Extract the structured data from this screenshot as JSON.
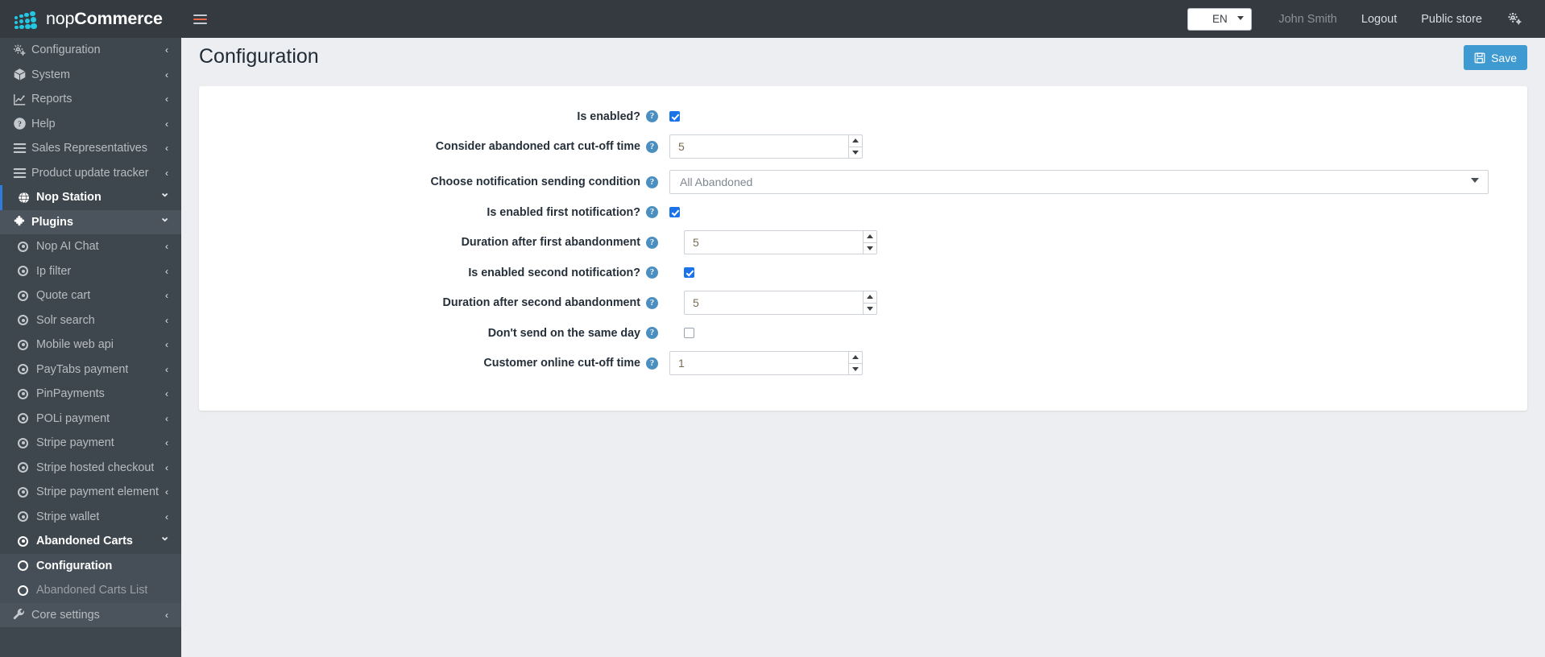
{
  "topbar": {
    "brand_light": "nop",
    "brand_bold": "Commerce",
    "menu_icon": "hamburger-icon",
    "language": "EN",
    "user": "John Smith",
    "logout": "Logout",
    "public_store": "Public store",
    "settings_icon": "gear-icon"
  },
  "sidebar": {
    "items": [
      {
        "label": "Configuration",
        "icon": "gears-icon",
        "caret": "‹",
        "level": 0,
        "style": "normal"
      },
      {
        "label": "System",
        "icon": "box-icon",
        "caret": "‹",
        "level": 0,
        "style": "normal"
      },
      {
        "label": "Reports",
        "icon": "chart-icon",
        "caret": "‹",
        "level": 0,
        "style": "normal"
      },
      {
        "label": "Help",
        "icon": "question-circle-icon",
        "caret": "‹",
        "level": 0,
        "style": "normal"
      },
      {
        "label": "Sales Representatives",
        "icon": "list-icon",
        "caret": "‹",
        "level": 0,
        "style": "normal"
      },
      {
        "label": "Product update tracker",
        "icon": "list-icon",
        "caret": "‹",
        "level": 0,
        "style": "normal"
      },
      {
        "label": "Nop Station",
        "icon": "globe-icon",
        "caret": "⌄",
        "level": 0,
        "style": "accent-bold"
      },
      {
        "label": "Plugins",
        "icon": "puzzle-icon",
        "caret": "⌄",
        "level": 0,
        "style": "highlight-bold"
      },
      {
        "label": "Nop AI Chat",
        "icon": "radio-icon",
        "caret": "‹",
        "level": 1,
        "style": "normal"
      },
      {
        "label": "Ip filter",
        "icon": "radio-icon",
        "caret": "‹",
        "level": 1,
        "style": "normal"
      },
      {
        "label": "Quote cart",
        "icon": "radio-icon",
        "caret": "‹",
        "level": 1,
        "style": "normal"
      },
      {
        "label": "Solr search",
        "icon": "radio-icon",
        "caret": "‹",
        "level": 1,
        "style": "normal"
      },
      {
        "label": "Mobile web api",
        "icon": "radio-icon",
        "caret": "‹",
        "level": 1,
        "style": "normal"
      },
      {
        "label": "PayTabs payment",
        "icon": "radio-icon",
        "caret": "‹",
        "level": 1,
        "style": "normal"
      },
      {
        "label": "PinPayments",
        "icon": "radio-icon",
        "caret": "‹",
        "level": 1,
        "style": "normal"
      },
      {
        "label": "POLi payment",
        "icon": "radio-icon",
        "caret": "‹",
        "level": 1,
        "style": "normal"
      },
      {
        "label": "Stripe payment",
        "icon": "radio-icon",
        "caret": "‹",
        "level": 1,
        "style": "normal"
      },
      {
        "label": "Stripe hosted checkout",
        "icon": "radio-icon",
        "caret": "‹",
        "level": 1,
        "style": "normal"
      },
      {
        "label": "Stripe payment element",
        "icon": "radio-icon",
        "caret": "‹",
        "level": 1,
        "style": "normal"
      },
      {
        "label": "Stripe wallet",
        "icon": "radio-icon",
        "caret": "‹",
        "level": 1,
        "style": "normal"
      },
      {
        "label": "Abandoned Carts",
        "icon": "radio-icon",
        "caret": "⌄",
        "level": 1,
        "style": "bold-white"
      },
      {
        "label": "Configuration",
        "icon": "circle-icon",
        "caret": "",
        "level": 1,
        "style": "active"
      },
      {
        "label": "Abandoned Carts List",
        "icon": "circle-icon",
        "caret": "",
        "level": 1,
        "style": "sub-dim"
      },
      {
        "label": "Core settings",
        "icon": "wrench-icon",
        "caret": "‹",
        "level": 0,
        "style": "highlight"
      }
    ]
  },
  "page": {
    "title": "Configuration",
    "save_label": "Save",
    "save_icon": "floppy-disk-icon"
  },
  "form": {
    "help_glyph": "?",
    "rows": [
      {
        "label": "Is enabled?",
        "type": "checkbox",
        "value": true,
        "nested": false
      },
      {
        "label": "Consider abandoned cart cut-off time",
        "type": "number",
        "value": "5",
        "nested": false
      },
      {
        "label": "Choose notification sending condition",
        "type": "select",
        "value": "All Abandoned",
        "nested": false,
        "options": [
          "All Abandoned"
        ]
      },
      {
        "label": "Is enabled first notification?",
        "type": "checkbox",
        "value": true,
        "nested": false
      },
      {
        "label": "Duration after first abandonment",
        "type": "number",
        "value": "5",
        "nested": true
      },
      {
        "label": "Is enabled second notification?",
        "type": "checkbox",
        "value": true,
        "nested": true
      },
      {
        "label": "Duration after second abandonment",
        "type": "number",
        "value": "5",
        "nested": true
      },
      {
        "label": "Don't send on the same day",
        "type": "checkbox",
        "value": false,
        "nested": true
      },
      {
        "label": "Customer online cut-off time",
        "type": "number",
        "value": "1",
        "nested": false
      }
    ]
  },
  "colors": {
    "topbar_bg": "#343a40",
    "sidebar_bg": "#3f474e",
    "accent_blue": "#2f7de1",
    "brand_cyan": "#24c6e0",
    "save_blue": "#3f9ad1",
    "help_blue": "#4b8fc0",
    "checkbox_on": "#1a73e8",
    "page_bg": "#eceef1"
  }
}
